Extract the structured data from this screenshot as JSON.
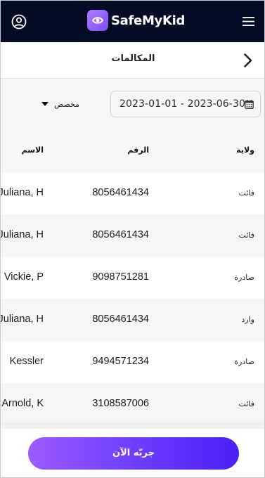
{
  "app": {
    "brand": "SafeMyKid",
    "accent_color": "#7a4dff",
    "topbar_color": "#060b26"
  },
  "icons": {
    "user": "user-circle-icon",
    "menu": "hamburger-menu-icon",
    "back": "chevron-right-icon",
    "calendar": "calendar-icon",
    "caret": "caret-down-icon"
  },
  "header": {
    "title": "المكالمات"
  },
  "filters": {
    "date_range": "2023-01-01 - 2023-06-30",
    "range_mode": "مخصص"
  },
  "table": {
    "columns": {
      "status": "ولاية",
      "number": "الرقم",
      "name": "الاسم"
    },
    "rows": [
      {
        "status": "فائت",
        "number": "8056461434",
        "name": "Juliana, H"
      },
      {
        "status": "فائت",
        "number": "8056461434",
        "name": "Juliana, H"
      },
      {
        "status": "صادرة",
        "number": "9098751281",
        "name": "Vickie, P"
      },
      {
        "status": "وارد",
        "number": "8056461434",
        "name": "Juliana, H"
      },
      {
        "status": "صادرة",
        "number": "9494571234",
        "name": "Kessler"
      },
      {
        "status": "فائت",
        "number": "3108587006",
        "name": "Arnold, K"
      }
    ]
  },
  "cta": {
    "label": "جربّه الآن"
  }
}
